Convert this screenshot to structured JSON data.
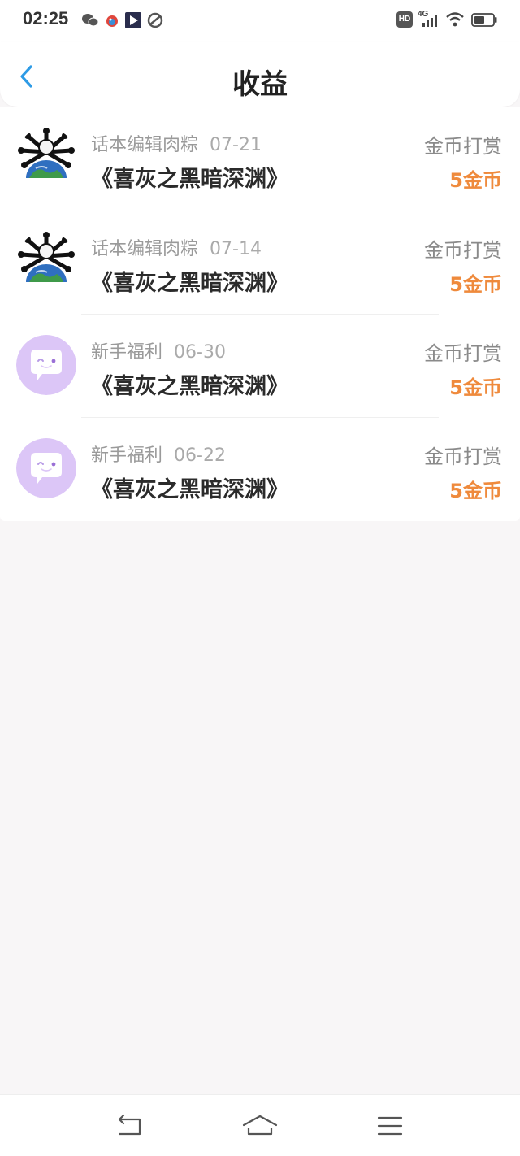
{
  "status_bar": {
    "time": "02:25",
    "hd_label": "HD",
    "network_label": "4G",
    "icons": [
      "wechat-icon",
      "bird-app-icon",
      "video-app-icon",
      "link-app-icon",
      "signal-icon",
      "wifi-icon",
      "battery-icon"
    ]
  },
  "header": {
    "title": "收益",
    "back_icon": "chevron-left-icon"
  },
  "earnings": [
    {
      "source": "话本编辑肉粽",
      "date": "07-21",
      "book": "《喜灰之黑暗深渊》",
      "type": "金币打赏",
      "amount": "5金币",
      "avatar": "earth-avatar"
    },
    {
      "source": "话本编辑肉粽",
      "date": "07-14",
      "book": "《喜灰之黑暗深渊》",
      "type": "金币打赏",
      "amount": "5金币",
      "avatar": "earth-avatar"
    },
    {
      "source": "新手福利",
      "date": "06-30",
      "book": "《喜灰之黑暗深渊》",
      "type": "金币打赏",
      "amount": "5金币",
      "avatar": "chat-bubble-avatar"
    },
    {
      "source": "新手福利",
      "date": "06-22",
      "book": "《喜灰之黑暗深渊》",
      "type": "金币打赏",
      "amount": "5金币",
      "avatar": "chat-bubble-avatar"
    }
  ],
  "nav_bar": {
    "icons": [
      "back-nav-icon",
      "home-nav-icon",
      "menu-nav-icon"
    ]
  },
  "colors": {
    "accent_blue": "#2e9be6",
    "amount_orange": "#ef8a3c",
    "avatar_purple": "#dcc6f7",
    "background": "#f8f6f7"
  }
}
